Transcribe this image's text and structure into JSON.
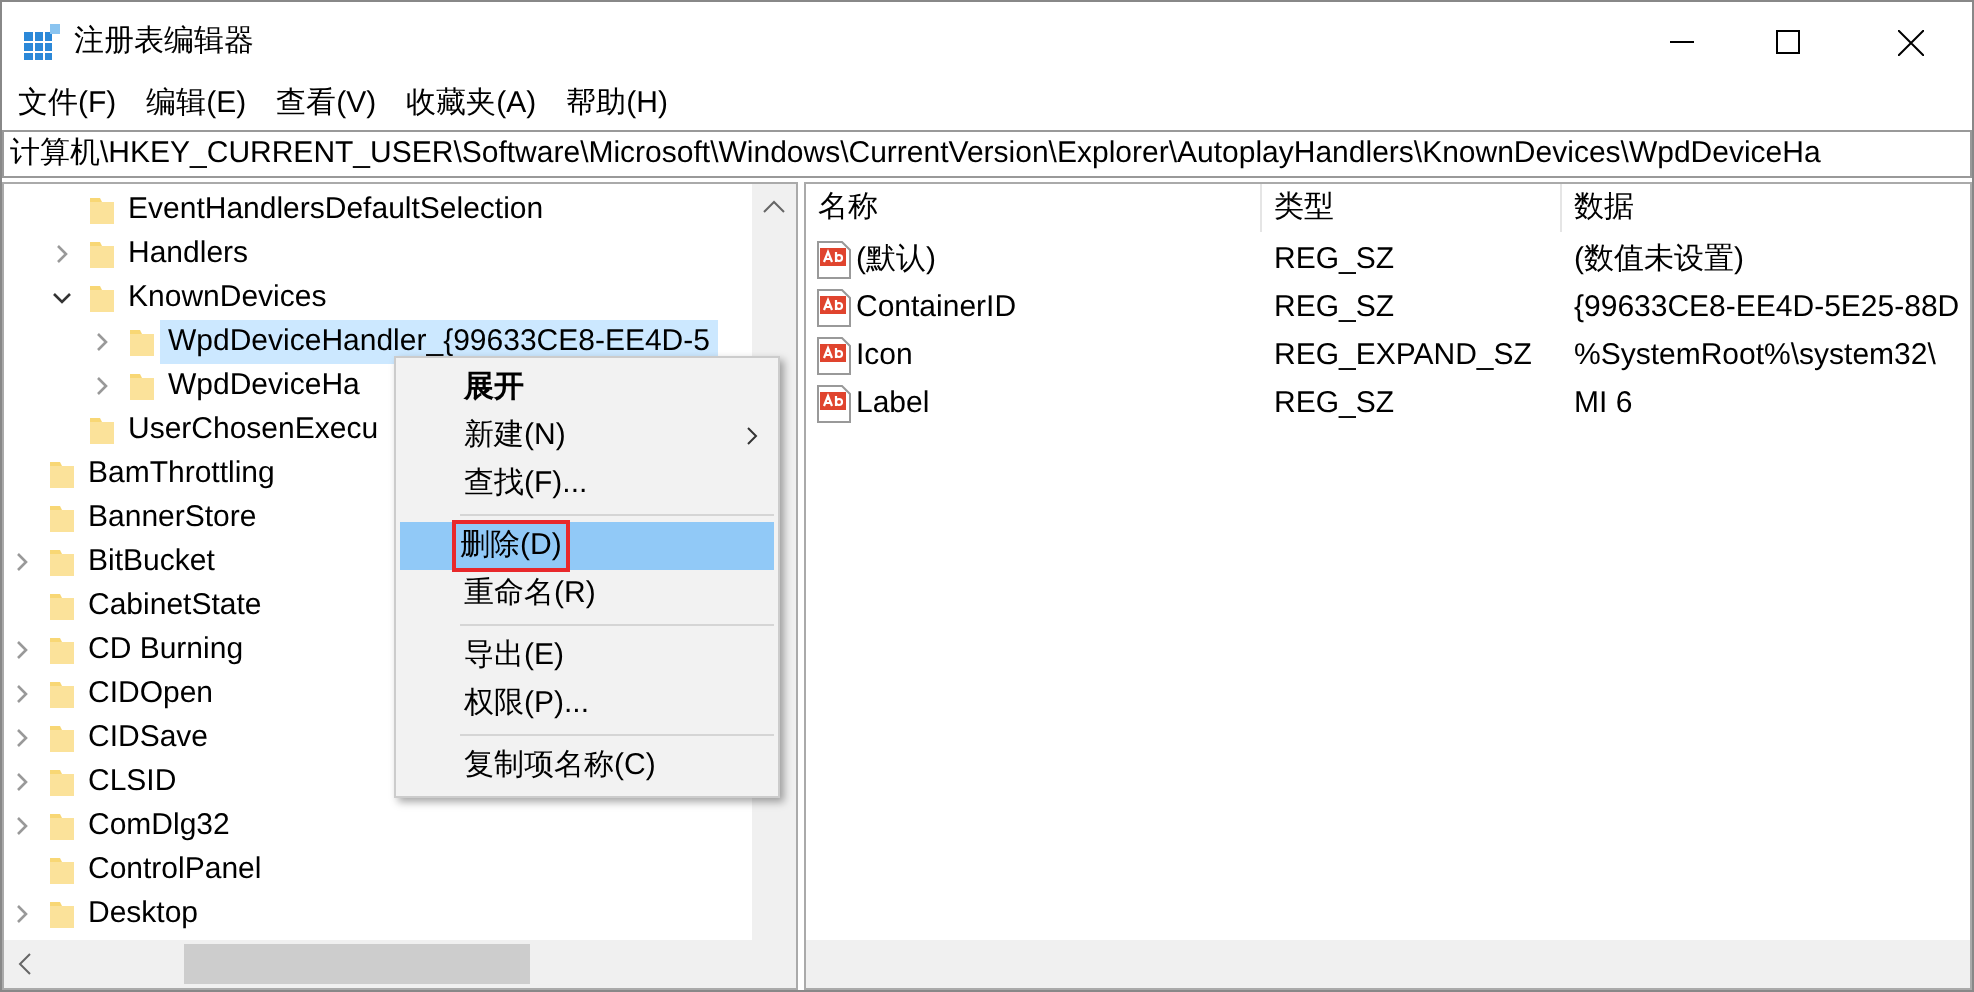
{
  "window": {
    "title": "注册表编辑器"
  },
  "menu_bar": [
    "文件(F)",
    "编辑(E)",
    "查看(V)",
    "收藏夹(A)",
    "帮助(H)"
  ],
  "address": "计算机\\HKEY_CURRENT_USER\\Software\\Microsoft\\Windows\\CurrentVersion\\Explorer\\AutoplayHandlers\\KnownDevices\\WpdDeviceHa",
  "tree": {
    "continued_branch": [
      {
        "label": "EventHandlersDefaultSelection",
        "has_children": false,
        "selected": false
      },
      {
        "label": "Handlers",
        "has_children": true,
        "expanded": false,
        "selected": false
      },
      {
        "label": "KnownDevices",
        "has_children": true,
        "expanded": true,
        "selected": false,
        "children": [
          {
            "label": "WpdDeviceHandler_{99633CE8-EE4D-5",
            "has_children": true,
            "expanded": false,
            "selected": true
          },
          {
            "label": "WpdDeviceHa",
            "has_children": true,
            "expanded": false,
            "selected": false
          }
        ]
      },
      {
        "label": "UserChosenExecu",
        "has_children": false,
        "selected": false
      }
    ],
    "items": [
      {
        "label": "BamThrottling",
        "has_children": false,
        "selected": false
      },
      {
        "label": "BannerStore",
        "has_children": false,
        "selected": false
      },
      {
        "label": "BitBucket",
        "has_children": true,
        "expanded": false,
        "selected": false
      },
      {
        "label": "CabinetState",
        "has_children": false,
        "selected": false
      },
      {
        "label": "CD Burning",
        "has_children": true,
        "expanded": false,
        "selected": false
      },
      {
        "label": "CIDOpen",
        "has_children": true,
        "expanded": false,
        "selected": false
      },
      {
        "label": "CIDSave",
        "has_children": true,
        "expanded": false,
        "selected": false
      },
      {
        "label": "CLSID",
        "has_children": true,
        "expanded": false,
        "selected": false
      },
      {
        "label": "ComDlg32",
        "has_children": true,
        "expanded": false,
        "selected": false
      },
      {
        "label": "ControlPanel",
        "has_children": false,
        "selected": false
      },
      {
        "label": "Desktop",
        "has_children": true,
        "expanded": false,
        "selected": false
      }
    ]
  },
  "values_table": {
    "columns": [
      "名称",
      "类型",
      "数据"
    ],
    "rows": [
      {
        "name": "(默认)",
        "type": "REG_SZ",
        "data": "(数值未设置)"
      },
      {
        "name": "ContainerID",
        "type": "REG_SZ",
        "data": "{99633CE8-EE4D-5E25-88D"
      },
      {
        "name": "Icon",
        "type": "REG_EXPAND_SZ",
        "data": "%SystemRoot%\\system32\\"
      },
      {
        "name": "Label",
        "type": "REG_SZ",
        "data": "MI 6"
      }
    ]
  },
  "context_menu": [
    {
      "kind": "item",
      "label": "展开",
      "default": true,
      "submenu": false,
      "selected": false,
      "highlight_box": false
    },
    {
      "kind": "item",
      "label": "新建(N)",
      "default": false,
      "submenu": true,
      "selected": false,
      "highlight_box": false
    },
    {
      "kind": "item",
      "label": "查找(F)...",
      "default": false,
      "submenu": false,
      "selected": false,
      "highlight_box": false
    },
    {
      "kind": "separator"
    },
    {
      "kind": "item",
      "label": "删除(D)",
      "default": false,
      "submenu": false,
      "selected": true,
      "highlight_box": true
    },
    {
      "kind": "item",
      "label": "重命名(R)",
      "default": false,
      "submenu": false,
      "selected": false,
      "highlight_box": false
    },
    {
      "kind": "separator"
    },
    {
      "kind": "item",
      "label": "导出(E)",
      "default": false,
      "submenu": false,
      "selected": false,
      "highlight_box": false
    },
    {
      "kind": "item",
      "label": "权限(P)...",
      "default": false,
      "submenu": false,
      "selected": false,
      "highlight_box": false
    },
    {
      "kind": "separator"
    },
    {
      "kind": "item",
      "label": "复制项名称(C)",
      "default": false,
      "submenu": false,
      "selected": false,
      "highlight_box": false
    }
  ]
}
